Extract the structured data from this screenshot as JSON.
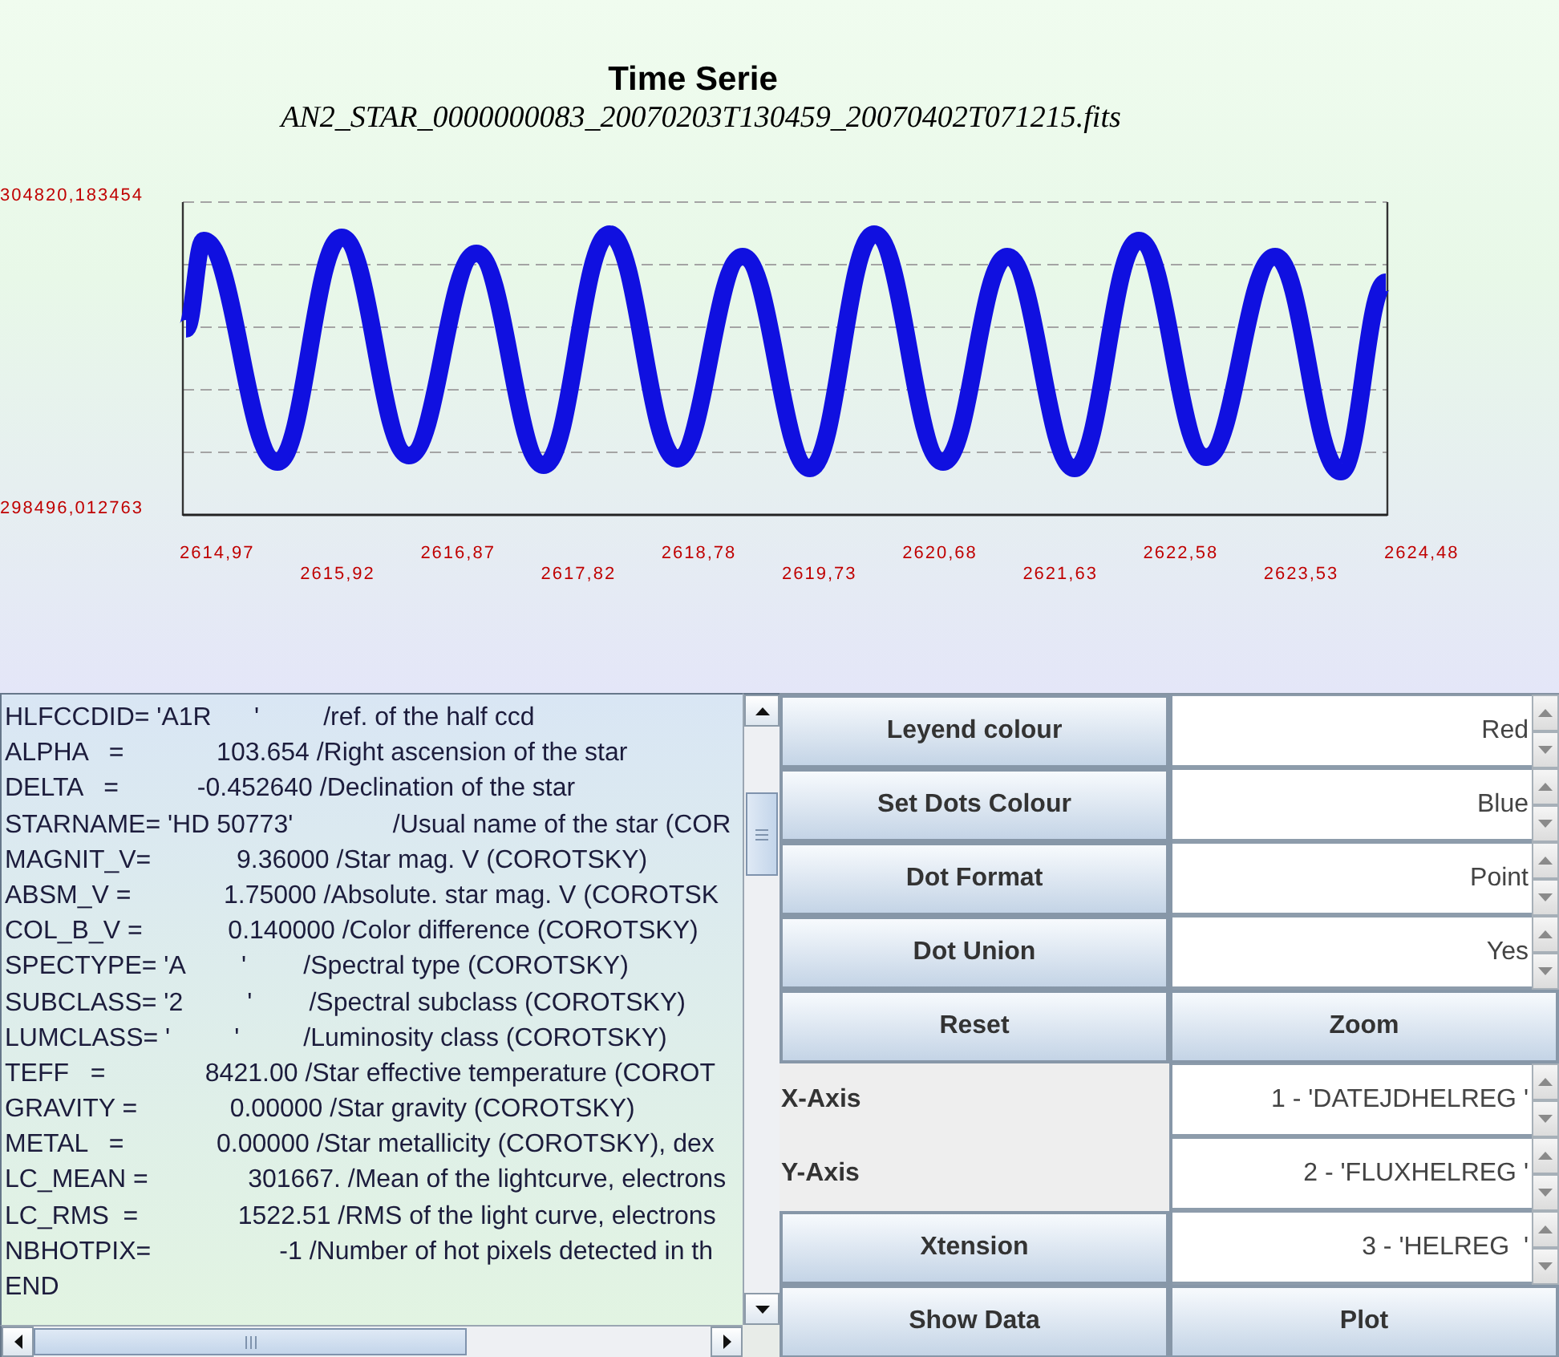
{
  "plot": {
    "title": "Time Serie",
    "subtitle": "AN2_STAR_0000000083_20070203T130459_20070402T071215.fits",
    "y_labels": [
      "304820,183454",
      "298496,012763"
    ],
    "x_labels": [
      "2614,97",
      "2615,92",
      "2616,87",
      "2617,82",
      "2618,78",
      "2619,73",
      "2620,68",
      "2621,63",
      "2622,58",
      "2623,53",
      "2624,48"
    ]
  },
  "header_listing": {
    "lines": [
      "HLFCCDID= 'A1R      '         /ref. of the half ccd",
      "ALPHA   =             103.654 /Right ascension of the star",
      "DELTA   =           -0.452640 /Declination of the star",
      "STARNAME= 'HD 50773'              /Usual name of the star (COR",
      "MAGNIT_V=            9.36000 /Star mag. V (COROTSKY)",
      "ABSM_V =             1.75000 /Absolute. star mag. V (COROTSK",
      "COL_B_V =            0.140000 /Color difference (COROTSKY)",
      "SPECTYPE= 'A        '        /Spectral type (COROTSKY)",
      "SUBCLASS= '2         '        /Spectral subclass (COROTSKY)",
      "LUMCLASS= '         '         /Luminosity class (COROTSKY)",
      "TEFF   =              8421.00 /Star effective temperature (COROT",
      "GRAVITY =             0.00000 /Star gravity (COROTSKY)",
      "METAL   =             0.00000 /Star metallicity (COROTSKY), dex",
      "LC_MEAN =              301667. /Mean of the lightcurve, electrons",
      "LC_RMS  =              1522.51 /RMS of the light curve, electrons",
      "NBHOTPIX=                  -1 /Number of hot pixels detected in th",
      "END"
    ]
  },
  "controls": {
    "rows": [
      {
        "kind": "option",
        "button": "Leyend colour",
        "value": "Red"
      },
      {
        "kind": "option",
        "button": "Set Dots Colour",
        "value": "Blue"
      },
      {
        "kind": "option",
        "button": "Dot Format",
        "value": "Point"
      },
      {
        "kind": "option",
        "button": "Dot Union",
        "value": "Yes"
      },
      {
        "kind": "actions",
        "buttons": [
          "Reset",
          "Zoom"
        ]
      },
      {
        "kind": "axis",
        "label": "X-Axis",
        "value": "1 - 'DATEJDHELREG '"
      },
      {
        "kind": "axis",
        "label": "Y-Axis",
        "value": "2 - 'FLUXHELREG '"
      },
      {
        "kind": "option",
        "button": "Xtension",
        "value": "3 - 'HELREG  '"
      },
      {
        "kind": "actions",
        "buttons": [
          "Show Data",
          "Plot"
        ]
      }
    ]
  }
}
